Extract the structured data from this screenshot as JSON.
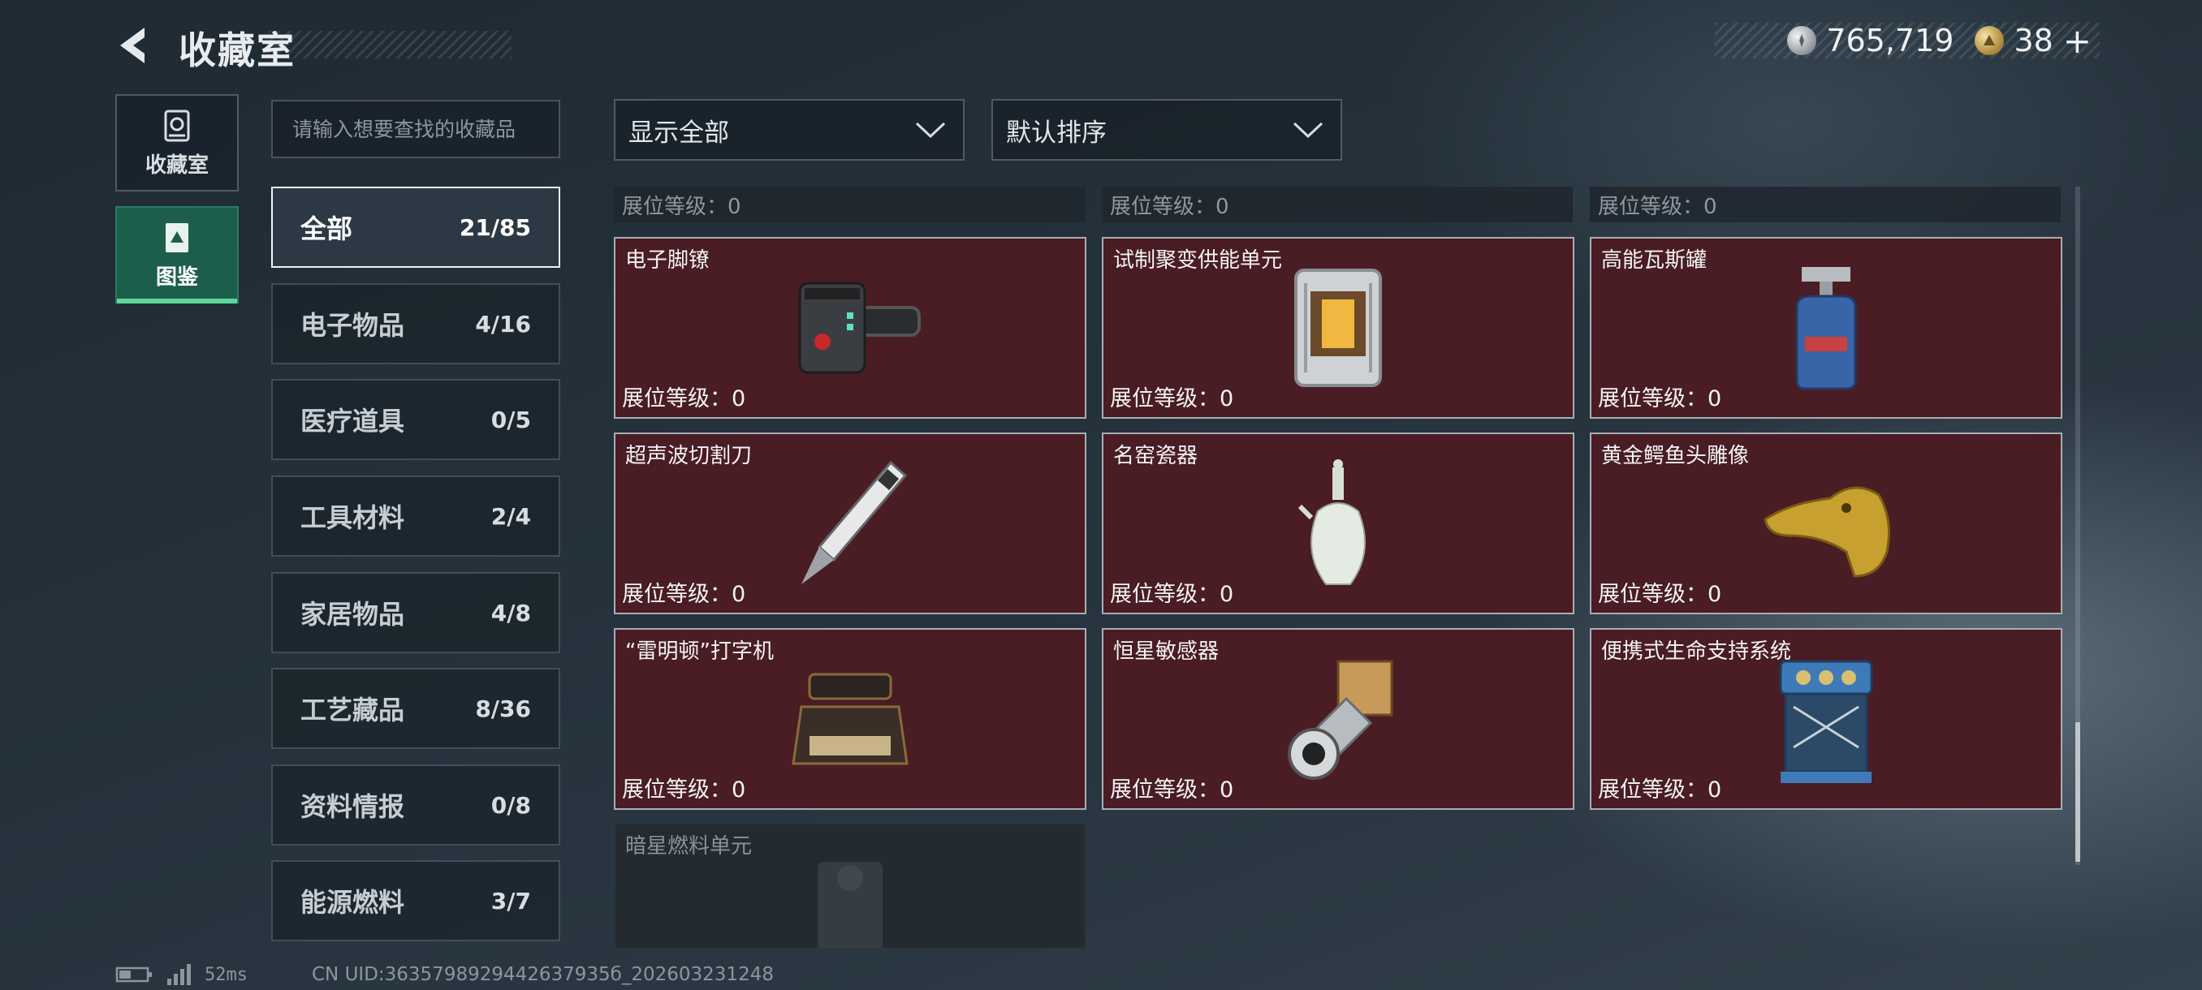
{
  "header": {
    "title": "收藏室",
    "currency": [
      {
        "icon": "silver-coin-icon",
        "value": "765,719"
      },
      {
        "icon": "gold-coin-icon",
        "value": "38"
      }
    ],
    "add_symbol": "+"
  },
  "nav": {
    "collection_room": "收藏室",
    "gallery": "图鉴"
  },
  "search": {
    "placeholder": "请输入想要查找的收藏品"
  },
  "categories": [
    {
      "name": "全部",
      "count": "21/85"
    },
    {
      "name": "电子物品",
      "count": "4/16"
    },
    {
      "name": "医疗道具",
      "count": "0/5"
    },
    {
      "name": "工具材料",
      "count": "2/4"
    },
    {
      "name": "家居物品",
      "count": "4/8"
    },
    {
      "name": "工艺藏品",
      "count": "8/36"
    },
    {
      "name": "资料情报",
      "count": "0/8"
    },
    {
      "name": "能源燃料",
      "count": "3/7"
    }
  ],
  "filters": {
    "show": "显示全部",
    "sort": "默认排序"
  },
  "level_label": "展位等级：0",
  "items": [
    {
      "name": "电子脚镣",
      "level": "展位等级：0",
      "icon": "electronic-anklet-icon"
    },
    {
      "name": "试制聚变供能单元",
      "level": "展位等级：0",
      "icon": "fusion-power-unit-icon"
    },
    {
      "name": "高能瓦斯罐",
      "level": "展位等级：0",
      "icon": "gas-canister-icon"
    },
    {
      "name": "超声波切割刀",
      "level": "展位等级：0",
      "icon": "ultrasonic-knife-icon"
    },
    {
      "name": "名窑瓷器",
      "level": "展位等级：0",
      "icon": "porcelain-vase-icon"
    },
    {
      "name": "黄金鳄鱼头雕像",
      "level": "展位等级：0",
      "icon": "golden-crocodile-icon"
    },
    {
      "name": "“雷明顿”打字机",
      "level": "展位等级：0",
      "icon": "typewriter-icon"
    },
    {
      "name": "恒星敏感器",
      "level": "展位等级：0",
      "icon": "star-sensor-icon"
    },
    {
      "name": "便携式生命支持系统",
      "level": "展位等级：0",
      "icon": "life-support-icon"
    },
    {
      "name": "暗星燃料单元",
      "icon": "dark-star-fuel-icon"
    }
  ],
  "status": {
    "ping": "52ms",
    "uid": "CN UID:3635798929442637935б_202603231248"
  },
  "colors": {
    "owned_card": "#4a1c23",
    "locked_card": "#232b31",
    "active_nav": "#1c5e4b",
    "accent_green": "#5fd69a"
  }
}
